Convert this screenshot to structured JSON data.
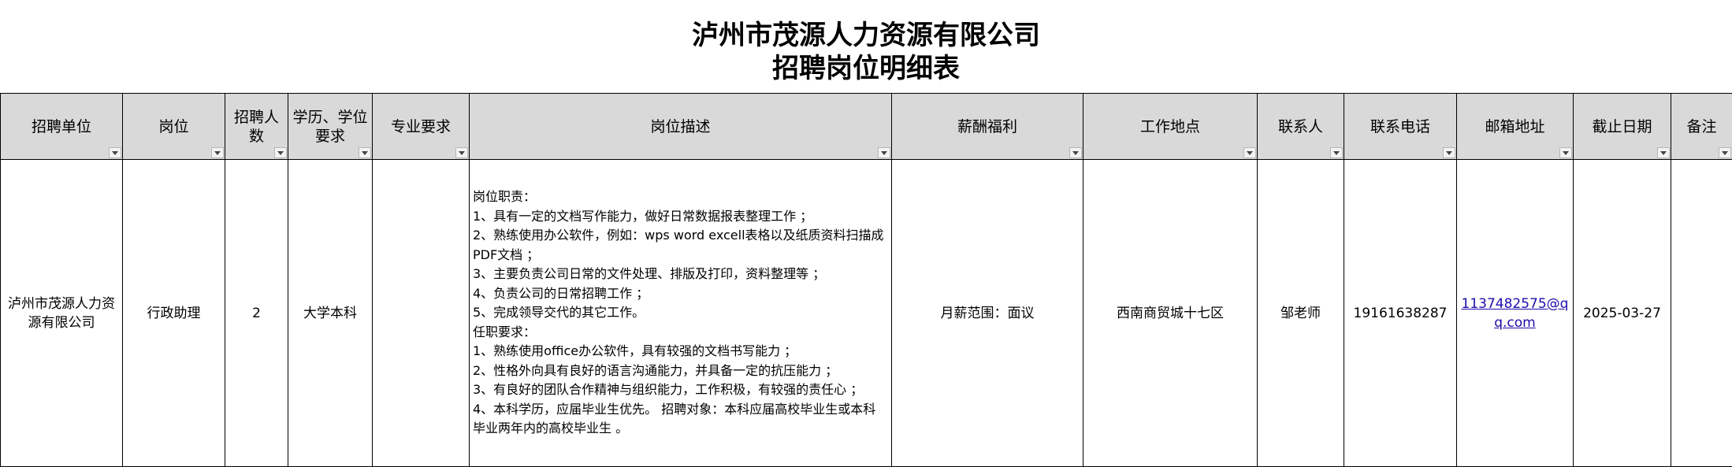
{
  "title": {
    "line1": "泸州市茂源人力资源有限公司",
    "line2": "招聘岗位明细表"
  },
  "headers": [
    "招聘单位",
    "岗位",
    "招聘人数",
    "学历、学位要求",
    "专业要求",
    "岗位描述",
    "薪酬福利",
    "工作地点",
    "联系人",
    "联系电话",
    "邮箱地址",
    "截止日期",
    "备注"
  ],
  "row": {
    "unit": "泸州市茂源人力资源有限公司",
    "position": "行政助理",
    "count": "2",
    "education": "大学本科",
    "major": "",
    "description": [
      "岗位职责：",
      "1、具有一定的文档写作能力，做好日常数据报表整理工作 ；",
      "2、熟练使用办公软件，例如：wps word excell表格以及纸质资料扫描成PDF文档 ；",
      "3、主要负责公司日常的文件处理、排版及打印，资料整理等 ；",
      "4、负责公司的日常招聘工作 ；",
      "5、完成领导交代的其它工作。",
      "任职要求：",
      "1、熟练使用office办公软件，具有较强的文档书写能力 ；",
      "2、性格外向具有良好的语言沟通能力，并具备一定的抗压能力 ；",
      "3、有良好的团队合作精神与组织能力，工作积极，有较强的责任心 ；",
      "4、本科学历，应届毕业生优先。  招聘对象：本科应届高校毕业生或本科毕业两年内的高校毕业生 。"
    ],
    "salary": "月薪范围：面议",
    "location": "西南商贸城十七区",
    "contact": "邹老师",
    "phone": "19161638287",
    "email": "1137482575@qq.com",
    "deadline": "2025-03-27",
    "remark": ""
  }
}
